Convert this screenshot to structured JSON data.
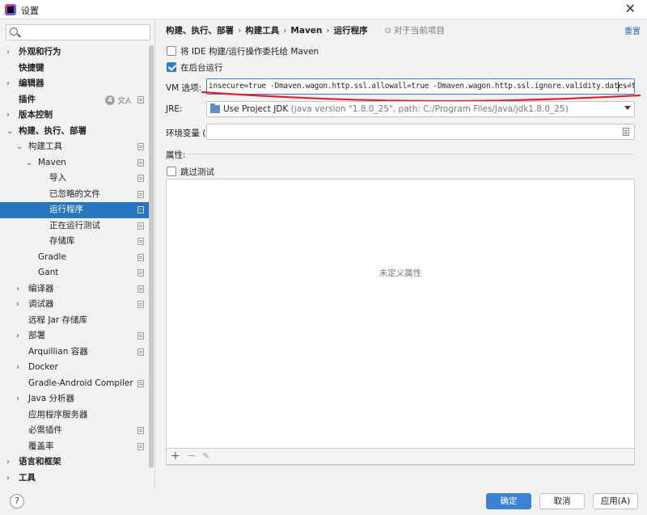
{
  "window": {
    "title": "设置",
    "close_icon": "close-icon"
  },
  "sidebar": {
    "search_placeholder": "",
    "badge": "4",
    "items": [
      {
        "label": "外观和行为",
        "bold": true,
        "expander": "›"
      },
      {
        "label": "快捷键",
        "bold": true,
        "expander": ""
      },
      {
        "label": "编辑器",
        "bold": true,
        "expander": "›"
      },
      {
        "label": "插件",
        "bold": true,
        "expander": ""
      },
      {
        "label": "版本控制",
        "bold": true,
        "expander": "›"
      },
      {
        "label": "构建、执行、部署",
        "bold": true,
        "expander": "⌄"
      },
      {
        "label": "构建工具",
        "bold": false,
        "expander": "⌄"
      },
      {
        "label": "Maven",
        "bold": false,
        "expander": "⌄"
      },
      {
        "label": "导入",
        "bold": false,
        "expander": ""
      },
      {
        "label": "已忽略的文件",
        "bold": false,
        "expander": ""
      },
      {
        "label": "运行程序",
        "bold": false,
        "expander": "",
        "selected": true
      },
      {
        "label": "正在运行测试",
        "bold": false,
        "expander": ""
      },
      {
        "label": "存储库",
        "bold": false,
        "expander": ""
      },
      {
        "label": "Gradle",
        "bold": false,
        "expander": ""
      },
      {
        "label": "Gant",
        "bold": false,
        "expander": ""
      },
      {
        "label": "编译器",
        "bold": false,
        "expander": "›"
      },
      {
        "label": "调试器",
        "bold": false,
        "expander": "›"
      },
      {
        "label": "远程 Jar 存储库",
        "bold": false,
        "expander": ""
      },
      {
        "label": "部署",
        "bold": false,
        "expander": "›"
      },
      {
        "label": "Arquillian 容器",
        "bold": false,
        "expander": ""
      },
      {
        "label": "Docker",
        "bold": false,
        "expander": "›"
      },
      {
        "label": "Gradle-Android Compiler",
        "bold": false,
        "expander": ""
      },
      {
        "label": "Java 分析器",
        "bold": false,
        "expander": "›"
      },
      {
        "label": "应用程序服务器",
        "bold": false,
        "expander": ""
      },
      {
        "label": "必需插件",
        "bold": false,
        "expander": ""
      },
      {
        "label": "覆盖率",
        "bold": false,
        "expander": ""
      },
      {
        "label": "语言和框架",
        "bold": true,
        "expander": "›"
      },
      {
        "label": "工具",
        "bold": true,
        "expander": "›"
      }
    ]
  },
  "breadcrumb": {
    "items": [
      "构建、执行、部署",
      "构建工具",
      "Maven",
      "运行程序"
    ],
    "separator": "›",
    "hint": "对于当前项目",
    "reset": "重置"
  },
  "options": {
    "delegate_label": "将 IDE 构建/运行操作委托给 Maven",
    "delegate_checked": false,
    "background_label": "在后台运行",
    "background_checked": true,
    "vm_label": "VM 选项:",
    "vm_value": "insecure=true -Dmaven.wagon.http.ssl.allowall=true -Dmaven.wagon.http.ssl.ignore.validity.dates=true",
    "jre_label": "JRE:",
    "jre_value": "Use Project JDK",
    "jre_detail": "(java version \"1.8.0_25\", path: C:/Program Files/Java/jdk1.8.0_25)",
    "env_label": "环境变量 (E):",
    "env_value": ""
  },
  "properties": {
    "title": "属性:",
    "skip_tests_label": "跳过测试",
    "skip_tests_checked": false,
    "empty_text": "未定义属性",
    "toolbar": {
      "add": "+",
      "remove": "−",
      "edit": "✎"
    }
  },
  "buttons": {
    "help": "?",
    "ok": "确定",
    "cancel": "取消",
    "apply": "应用(A)"
  },
  "colors": {
    "accent": "#2675bf",
    "annotation_red": "#e0202a"
  }
}
